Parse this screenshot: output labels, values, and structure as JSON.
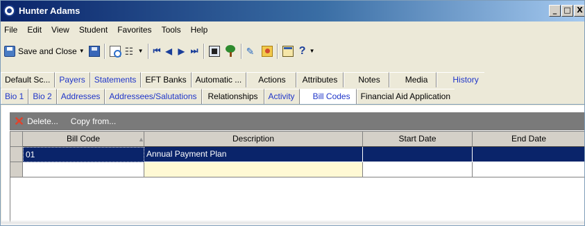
{
  "window": {
    "title": "Hunter Adams",
    "controls": {
      "minimize": "_",
      "maximize": "□",
      "close": "X"
    }
  },
  "menu": [
    "File",
    "Edit",
    "View",
    "Student",
    "Favorites",
    "Tools",
    "Help"
  ],
  "toolbar": {
    "save_close": "Save and Close",
    "icons": [
      "save-icon",
      "print-preview-icon",
      "tree-icon",
      "first-record-icon",
      "previous-record-icon",
      "next-record-icon",
      "last-record-icon",
      "calculator-icon",
      "family-tree-icon",
      "pen-icon",
      "folder-icon",
      "window-icon",
      "help-icon"
    ],
    "help": "?"
  },
  "tabs_row1": [
    {
      "label": "Default Sc...",
      "link": false
    },
    {
      "label": "Payers",
      "link": true
    },
    {
      "label": "Statements",
      "link": true
    },
    {
      "label": "EFT Banks",
      "link": false
    },
    {
      "label": "Automatic ...",
      "link": false
    },
    {
      "label": "Actions",
      "link": false
    },
    {
      "label": "Attributes",
      "link": false
    },
    {
      "label": "Notes",
      "link": false
    },
    {
      "label": "Media",
      "link": false
    },
    {
      "label": "History",
      "link": true
    }
  ],
  "tabs_row2": [
    {
      "label": "Bio 1",
      "link": true
    },
    {
      "label": "Bio 2",
      "link": true
    },
    {
      "label": "Addresses",
      "link": true
    },
    {
      "label": "Addressees/Salutations",
      "link": true
    },
    {
      "label": "Relationships",
      "link": false
    },
    {
      "label": "Activity",
      "link": true
    },
    {
      "label": "Bill Codes",
      "link": true,
      "active": true
    },
    {
      "label": "Financial Aid Application",
      "link": false
    }
  ],
  "actions": {
    "delete": "Delete...",
    "copy_from": "Copy from..."
  },
  "grid": {
    "columns": [
      "Bill Code",
      "Description",
      "Start Date",
      "End Date"
    ],
    "sort_indicator": "▲",
    "rows": [
      {
        "bill_code": "01",
        "description": "Annual Payment Plan",
        "start_date": "",
        "end_date": ""
      },
      {
        "bill_code": "",
        "description": "",
        "start_date": "",
        "end_date": ""
      }
    ]
  },
  "colors": {
    "title_bar": "#0a246a",
    "link": "#1f35c9",
    "selection": "#0a246a",
    "action_bar": "#7a7a7a",
    "delete": "#e2422b"
  }
}
